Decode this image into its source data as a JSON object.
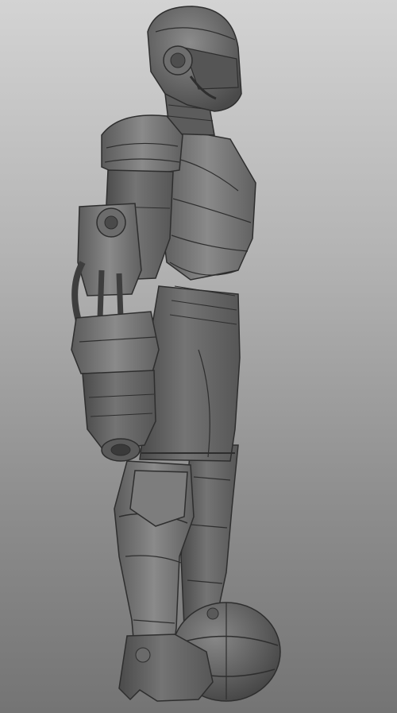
{
  "scene": {
    "subject": "armored-figure-sculpt",
    "colors": {
      "background_top": "#d3d3d3",
      "background_bottom": "#747474",
      "clay_base": "#6a6a6a",
      "clay_highlight": "#8a8a8a",
      "clay_shadow": "#3c3c3c",
      "line_detail": "#2e2e2e"
    }
  }
}
